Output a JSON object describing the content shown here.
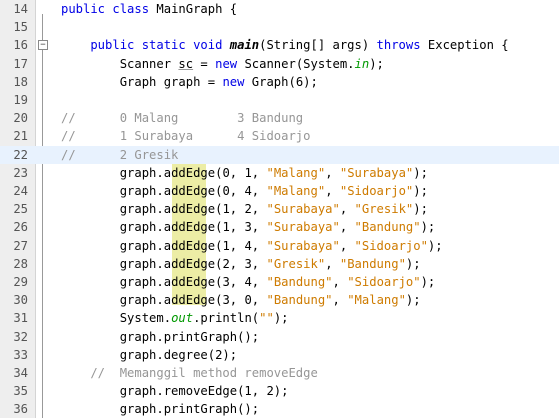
{
  "lines": [
    {
      "num": "14",
      "segments": [
        {
          "t": "public class ",
          "c": "#0000e6"
        },
        {
          "t": "MainGraph {",
          "c": "#000000"
        }
      ]
    },
    {
      "num": "15",
      "segments": []
    },
    {
      "num": "16",
      "segments": [
        {
          "t": "    public static void ",
          "c": "#0000e6"
        },
        {
          "t": "main",
          "c": "#000000",
          "b": true,
          "i": true
        },
        {
          "t": "(String[] args) ",
          "c": "#000000"
        },
        {
          "t": "throws",
          "c": "#0000e6"
        },
        {
          "t": " Exception {",
          "c": "#000000"
        }
      ]
    },
    {
      "num": "17",
      "segments": [
        {
          "t": "        Scanner ",
          "c": "#000000"
        },
        {
          "t": "sc",
          "c": "#000000",
          "u": true
        },
        {
          "t": " = ",
          "c": "#000000"
        },
        {
          "t": "new",
          "c": "#0000e6"
        },
        {
          "t": " Scanner(System.",
          "c": "#000000"
        },
        {
          "t": "in",
          "c": "#009900",
          "i": true
        },
        {
          "t": ");",
          "c": "#000000"
        }
      ]
    },
    {
      "num": "18",
      "segments": [
        {
          "t": "        Graph graph = ",
          "c": "#000000"
        },
        {
          "t": "new",
          "c": "#0000e6"
        },
        {
          "t": " Graph(6);",
          "c": "#000000"
        }
      ]
    },
    {
      "num": "19",
      "segments": []
    },
    {
      "num": "20",
      "segments": [
        {
          "t": "//      0 Malang        3 Bandung",
          "c": "#969696"
        }
      ]
    },
    {
      "num": "21",
      "segments": [
        {
          "t": "//      1 Surabaya      4 Sidoarjo",
          "c": "#969696"
        }
      ]
    },
    {
      "num": "22",
      "segments": [
        {
          "t": "//      2 Gresik",
          "c": "#969696"
        }
      ],
      "current": true
    },
    {
      "num": "23",
      "segments": [
        {
          "t": "        graph.",
          "c": "#000000"
        },
        {
          "t": "addEdge",
          "c": "#000000"
        },
        {
          "t": "(0, 1, ",
          "c": "#000000"
        },
        {
          "t": "\"Malang\"",
          "c": "#ce7b00"
        },
        {
          "t": ", ",
          "c": "#000000"
        },
        {
          "t": "\"Surabaya\"",
          "c": "#ce7b00"
        },
        {
          "t": ");",
          "c": "#000000"
        }
      ]
    },
    {
      "num": "24",
      "segments": [
        {
          "t": "        graph.",
          "c": "#000000"
        },
        {
          "t": "addEdge",
          "c": "#000000"
        },
        {
          "t": "(0, 4, ",
          "c": "#000000"
        },
        {
          "t": "\"Malang\"",
          "c": "#ce7b00"
        },
        {
          "t": ", ",
          "c": "#000000"
        },
        {
          "t": "\"Sidoarjo\"",
          "c": "#ce7b00"
        },
        {
          "t": ");",
          "c": "#000000"
        }
      ]
    },
    {
      "num": "25",
      "segments": [
        {
          "t": "        graph.",
          "c": "#000000"
        },
        {
          "t": "addEdge",
          "c": "#000000"
        },
        {
          "t": "(1, 2, ",
          "c": "#000000"
        },
        {
          "t": "\"Surabaya\"",
          "c": "#ce7b00"
        },
        {
          "t": ", ",
          "c": "#000000"
        },
        {
          "t": "\"Gresik\"",
          "c": "#ce7b00"
        },
        {
          "t": ");",
          "c": "#000000"
        }
      ]
    },
    {
      "num": "26",
      "segments": [
        {
          "t": "        graph.",
          "c": "#000000"
        },
        {
          "t": "addEdge",
          "c": "#000000"
        },
        {
          "t": "(1, 3, ",
          "c": "#000000"
        },
        {
          "t": "\"Surabaya\"",
          "c": "#ce7b00"
        },
        {
          "t": ", ",
          "c": "#000000"
        },
        {
          "t": "\"Bandung\"",
          "c": "#ce7b00"
        },
        {
          "t": ");",
          "c": "#000000"
        }
      ]
    },
    {
      "num": "27",
      "segments": [
        {
          "t": "        graph.",
          "c": "#000000"
        },
        {
          "t": "addEdge",
          "c": "#000000"
        },
        {
          "t": "(1, 4, ",
          "c": "#000000"
        },
        {
          "t": "\"Surabaya\"",
          "c": "#ce7b00"
        },
        {
          "t": ", ",
          "c": "#000000"
        },
        {
          "t": "\"Sidoarjo\"",
          "c": "#ce7b00"
        },
        {
          "t": ");",
          "c": "#000000"
        }
      ]
    },
    {
      "num": "28",
      "segments": [
        {
          "t": "        graph.",
          "c": "#000000"
        },
        {
          "t": "addEdge",
          "c": "#000000"
        },
        {
          "t": "(2, 3, ",
          "c": "#000000"
        },
        {
          "t": "\"Gresik\"",
          "c": "#ce7b00"
        },
        {
          "t": ", ",
          "c": "#000000"
        },
        {
          "t": "\"Bandung\"",
          "c": "#ce7b00"
        },
        {
          "t": ");",
          "c": "#000000"
        }
      ]
    },
    {
      "num": "29",
      "segments": [
        {
          "t": "        graph.",
          "c": "#000000"
        },
        {
          "t": "addEdge",
          "c": "#000000"
        },
        {
          "t": "(3, 4, ",
          "c": "#000000"
        },
        {
          "t": "\"Bandung\"",
          "c": "#ce7b00"
        },
        {
          "t": ", ",
          "c": "#000000"
        },
        {
          "t": "\"Sidoarjo\"",
          "c": "#ce7b00"
        },
        {
          "t": ");",
          "c": "#000000"
        }
      ]
    },
    {
      "num": "30",
      "segments": [
        {
          "t": "        graph.",
          "c": "#000000"
        },
        {
          "t": "addEdge",
          "c": "#000000"
        },
        {
          "t": "(3, 0, ",
          "c": "#000000"
        },
        {
          "t": "\"Bandung\"",
          "c": "#ce7b00"
        },
        {
          "t": ", ",
          "c": "#000000"
        },
        {
          "t": "\"Malang\"",
          "c": "#ce7b00"
        },
        {
          "t": ");",
          "c": "#000000"
        }
      ]
    },
    {
      "num": "31",
      "segments": [
        {
          "t": "        System.",
          "c": "#000000"
        },
        {
          "t": "out",
          "c": "#009900",
          "i": true
        },
        {
          "t": ".println(",
          "c": "#000000"
        },
        {
          "t": "\"\"",
          "c": "#ce7b00"
        },
        {
          "t": ");",
          "c": "#000000"
        }
      ]
    },
    {
      "num": "32",
      "segments": [
        {
          "t": "        graph.printGraph();",
          "c": "#000000"
        }
      ]
    },
    {
      "num": "33",
      "segments": [
        {
          "t": "        graph.degree(2);",
          "c": "#000000"
        }
      ]
    },
    {
      "num": "34",
      "segments": [
        {
          "t": "    //  Memanggil method removeEdge",
          "c": "#969696"
        }
      ]
    },
    {
      "num": "35",
      "segments": [
        {
          "t": "        graph.removeEdge(1, 2);",
          "c": "#000000"
        }
      ]
    },
    {
      "num": "36",
      "segments": [
        {
          "t": "        graph.printGraph();",
          "c": "#000000"
        }
      ]
    }
  ],
  "colors": {
    "keyword": "#0000e6",
    "string": "#ce7b00",
    "comment": "#969696",
    "field": "#009900",
    "occurrence_highlight": "#eceda5",
    "current_line": "#e8f2fe"
  },
  "fold_marker": "−"
}
